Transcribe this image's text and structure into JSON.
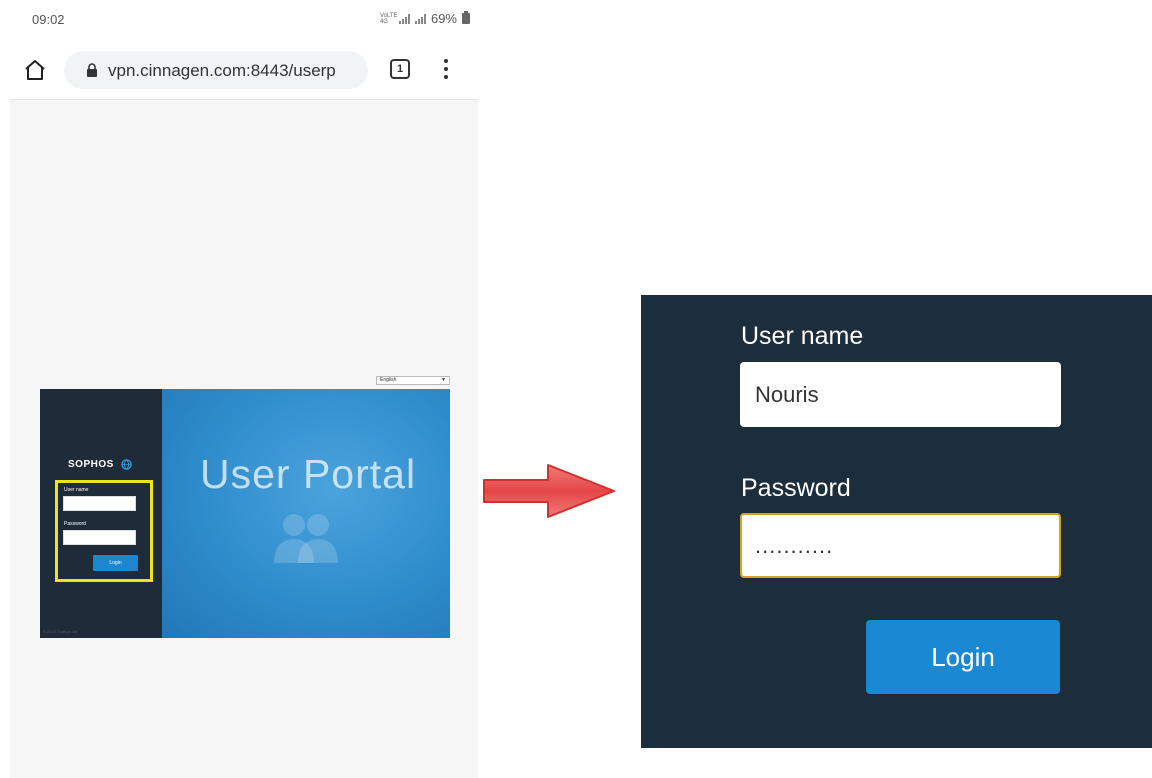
{
  "status_bar": {
    "time": "09:02",
    "network_indicator": "VoLTE 4G",
    "battery": "69%"
  },
  "browser": {
    "url": "vpn.cinnagen.com:8443/userp",
    "tab_count": "1"
  },
  "portal_thumbnail": {
    "language": "English",
    "brand": "SOPHOS",
    "title": "User Portal",
    "username_label": "User name",
    "password_label": "Password",
    "login_label": "Login",
    "copyright": "© 2020 Sophos Ltd."
  },
  "zoomed_login": {
    "username_label": "User name",
    "username_value": "Nouris",
    "password_label": "Password",
    "password_value": "...........",
    "login_label": "Login"
  },
  "colors": {
    "sidebar": "#1c2d3b",
    "login_button": "#1a88d2",
    "highlight": "#f2e21c",
    "arrow": "#e23b3b"
  },
  "icons": [
    "home-icon",
    "lock-icon",
    "tabs-icon",
    "menu-icon",
    "globe-icon",
    "users-icon",
    "arrow-icon"
  ]
}
